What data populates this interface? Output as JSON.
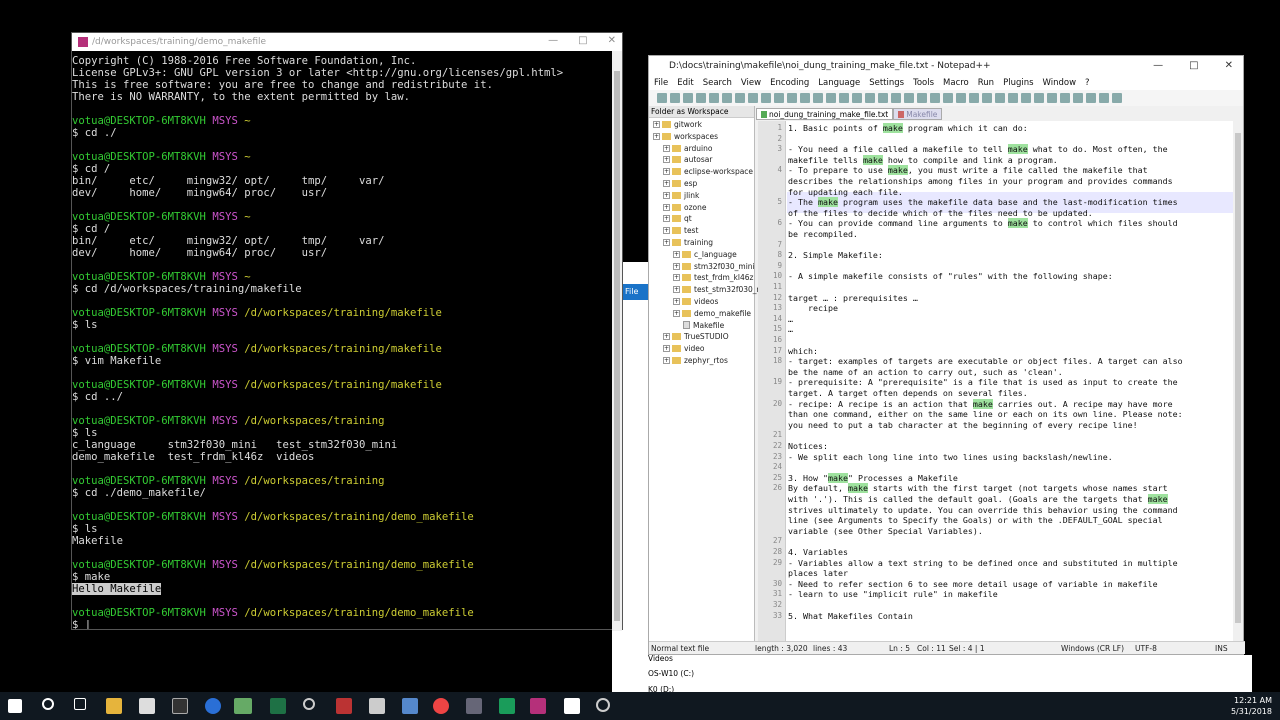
{
  "terminal": {
    "title": "/d/workspaces/training/demo_makefile",
    "lines": [
      [
        [
          "Copyright (C) 1988-2016 Free Software Foundation, Inc.",
          ""
        ]
      ],
      [
        [
          "License GPLv3+: GNU GPL version 3 or later <http://gnu.org/licenses/gpl.html>",
          ""
        ]
      ],
      [
        [
          "This is free software: you are free to change and redistribute it.",
          ""
        ]
      ],
      [
        [
          "There is NO WARRANTY, to the extent permitted by law.",
          ""
        ]
      ],
      [
        [
          "",
          ""
        ]
      ],
      [
        [
          "votua@DESKTOP-6MT8KVH",
          "t-user"
        ],
        [
          " MSYS",
          "t-msys"
        ],
        [
          " ~",
          "t-path"
        ]
      ],
      [
        [
          "$ cd ./",
          ""
        ]
      ],
      [
        [
          "",
          ""
        ]
      ],
      [
        [
          "votua@DESKTOP-6MT8KVH",
          "t-user"
        ],
        [
          " MSYS",
          "t-msys"
        ],
        [
          " ~",
          "t-path"
        ]
      ],
      [
        [
          "$ cd /",
          ""
        ]
      ],
      [
        [
          "bin/     etc/     mingw32/ opt/     tmp/     var/",
          ""
        ]
      ],
      [
        [
          "dev/     home/    mingw64/ proc/    usr/",
          ""
        ]
      ],
      [
        [
          "",
          ""
        ]
      ],
      [
        [
          "votua@DESKTOP-6MT8KVH",
          "t-user"
        ],
        [
          " MSYS",
          "t-msys"
        ],
        [
          " ~",
          "t-path"
        ]
      ],
      [
        [
          "$ cd /",
          ""
        ]
      ],
      [
        [
          "bin/     etc/     mingw32/ opt/     tmp/     var/",
          ""
        ]
      ],
      [
        [
          "dev/     home/    mingw64/ proc/    usr/",
          ""
        ]
      ],
      [
        [
          "",
          ""
        ]
      ],
      [
        [
          "votua@DESKTOP-6MT8KVH",
          "t-user"
        ],
        [
          " MSYS",
          "t-msys"
        ],
        [
          " ~",
          "t-path"
        ]
      ],
      [
        [
          "$ cd /d/workspaces/training/makefile",
          ""
        ]
      ],
      [
        [
          "",
          ""
        ]
      ],
      [
        [
          "votua@DESKTOP-6MT8KVH",
          "t-user"
        ],
        [
          " MSYS",
          "t-msys"
        ],
        [
          " /d/workspaces/training/makefile",
          "t-path"
        ]
      ],
      [
        [
          "$ ls",
          ""
        ]
      ],
      [
        [
          "",
          ""
        ]
      ],
      [
        [
          "votua@DESKTOP-6MT8KVH",
          "t-user"
        ],
        [
          " MSYS",
          "t-msys"
        ],
        [
          " /d/workspaces/training/makefile",
          "t-path"
        ]
      ],
      [
        [
          "$ vim Makefile",
          ""
        ]
      ],
      [
        [
          "",
          ""
        ]
      ],
      [
        [
          "votua@DESKTOP-6MT8KVH",
          "t-user"
        ],
        [
          " MSYS",
          "t-msys"
        ],
        [
          " /d/workspaces/training/makefile",
          "t-path"
        ]
      ],
      [
        [
          "$ cd ../",
          ""
        ]
      ],
      [
        [
          "",
          ""
        ]
      ],
      [
        [
          "votua@DESKTOP-6MT8KVH",
          "t-user"
        ],
        [
          " MSYS",
          "t-msys"
        ],
        [
          " /d/workspaces/training",
          "t-path"
        ]
      ],
      [
        [
          "$ ls",
          ""
        ]
      ],
      [
        [
          "c_language     stm32f030_mini   test_stm32f030_mini",
          ""
        ]
      ],
      [
        [
          "demo_makefile  test_frdm_kl46z  videos",
          ""
        ]
      ],
      [
        [
          "",
          ""
        ]
      ],
      [
        [
          "votua@DESKTOP-6MT8KVH",
          "t-user"
        ],
        [
          " MSYS",
          "t-msys"
        ],
        [
          " /d/workspaces/training",
          "t-path"
        ]
      ],
      [
        [
          "$ cd ./demo_makefile/",
          ""
        ]
      ],
      [
        [
          "",
          ""
        ]
      ],
      [
        [
          "votua@DESKTOP-6MT8KVH",
          "t-user"
        ],
        [
          " MSYS",
          "t-msys"
        ],
        [
          " /d/workspaces/training/demo_makefile",
          "t-path"
        ]
      ],
      [
        [
          "$ ls",
          ""
        ]
      ],
      [
        [
          "Makefile",
          ""
        ]
      ],
      [
        [
          "",
          ""
        ]
      ],
      [
        [
          "votua@DESKTOP-6MT8KVH",
          "t-user"
        ],
        [
          " MSYS",
          "t-msys"
        ],
        [
          " /d/workspaces/training/demo_makefile",
          "t-path"
        ]
      ],
      [
        [
          "$ make",
          ""
        ]
      ],
      [
        [
          "Hello Makefile",
          "t-hl"
        ]
      ],
      [
        [
          "",
          ""
        ]
      ],
      [
        [
          "votua@DESKTOP-6MT8KVH",
          "t-user"
        ],
        [
          " MSYS",
          "t-msys"
        ],
        [
          " /d/workspaces/training/demo_makefile",
          "t-path"
        ]
      ],
      [
        [
          "$ ",
          ""
        ]
      ]
    ]
  },
  "notepad": {
    "title": "D:\\docs\\training\\makefile\\noi_dung_training_make_file.txt - Notepad++",
    "menu": [
      "File",
      "Edit",
      "Search",
      "View",
      "Encoding",
      "Language",
      "Settings",
      "Tools",
      "Macro",
      "Run",
      "Plugins",
      "Window",
      "?"
    ],
    "panel_title": "Folder as Workspace",
    "tree": [
      {
        "label": "gitwork",
        "indent": 0,
        "type": "folder"
      },
      {
        "label": "workspaces",
        "indent": 0,
        "type": "folder"
      },
      {
        "label": "arduino",
        "indent": 1,
        "type": "folder"
      },
      {
        "label": "autosar",
        "indent": 1,
        "type": "folder"
      },
      {
        "label": "eclipse-workspace",
        "indent": 1,
        "type": "folder"
      },
      {
        "label": "esp",
        "indent": 1,
        "type": "folder"
      },
      {
        "label": "jlink",
        "indent": 1,
        "type": "folder"
      },
      {
        "label": "ozone",
        "indent": 1,
        "type": "folder"
      },
      {
        "label": "qt",
        "indent": 1,
        "type": "folder"
      },
      {
        "label": "test",
        "indent": 1,
        "type": "folder"
      },
      {
        "label": "training",
        "indent": 1,
        "type": "folder"
      },
      {
        "label": "c_language",
        "indent": 2,
        "type": "folder"
      },
      {
        "label": "stm32f030_mini",
        "indent": 2,
        "type": "folder"
      },
      {
        "label": "test_frdm_kl46z",
        "indent": 2,
        "type": "folder"
      },
      {
        "label": "test_stm32f030_mini",
        "indent": 2,
        "type": "folder"
      },
      {
        "label": "videos",
        "indent": 2,
        "type": "folder"
      },
      {
        "label": "demo_makefile",
        "indent": 2,
        "type": "folder"
      },
      {
        "label": "Makefile",
        "indent": 3,
        "type": "file"
      },
      {
        "label": "TrueSTUDIO",
        "indent": 1,
        "type": "folder"
      },
      {
        "label": "video",
        "indent": 1,
        "type": "folder"
      },
      {
        "label": "zephyr_rtos",
        "indent": 1,
        "type": "folder"
      }
    ],
    "tabs": [
      {
        "label": "noi_dung_training_make_file.txt",
        "active": true
      },
      {
        "label": "Makefile",
        "active": false
      }
    ],
    "editor_rows": [
      {
        "n": "1",
        "t": "1. Basic points of |make| program which it can do:"
      },
      {
        "n": "2",
        "t": ""
      },
      {
        "n": "3",
        "t": "- You need a file called a makefile to tell |make| what to do. Most often, the"
      },
      {
        "n": "",
        "t": "makefile tells |make| how to compile and link a program."
      },
      {
        "n": "4",
        "t": "- To prepare to use |make|, you must write a file called the makefile that"
      },
      {
        "n": "",
        "t": "describes the relationships among files in your program and provides commands"
      },
      {
        "n": "",
        "t": "for updating each file."
      },
      {
        "n": "5",
        "t": "- The |make| program uses the makefile data base and the last-modification times"
      },
      {
        "n": "",
        "t": "of the files to decide which of the files need to be updated."
      },
      {
        "n": "6",
        "t": "- You can provide command line arguments to |make| to control which files should"
      },
      {
        "n": "",
        "t": "be recompiled."
      },
      {
        "n": "7",
        "t": ""
      },
      {
        "n": "8",
        "t": "2. Simple Makefile:"
      },
      {
        "n": "9",
        "t": ""
      },
      {
        "n": "10",
        "t": "- A simple makefile consists of \"rules\" with the following shape:"
      },
      {
        "n": "11",
        "t": ""
      },
      {
        "n": "12",
        "t": "target … : prerequisites …"
      },
      {
        "n": "13",
        "t": "    recipe"
      },
      {
        "n": "14",
        "t": "…"
      },
      {
        "n": "15",
        "t": "…"
      },
      {
        "n": "16",
        "t": ""
      },
      {
        "n": "17",
        "t": "which:"
      },
      {
        "n": "18",
        "t": "- target: examples of targets are executable or object files. A target can also"
      },
      {
        "n": "",
        "t": "be the name of an action to carry out, such as 'clean'."
      },
      {
        "n": "19",
        "t": "- prerequisite: A \"prerequisite\" is a file that is used as input to create the"
      },
      {
        "n": "",
        "t": "target. A target often depends on several files."
      },
      {
        "n": "20",
        "t": "- recipe: A recipe is an action that |make| carries out. A recipe may have more"
      },
      {
        "n": "",
        "t": "than one command, either on the same line or each on its own line. Please note:"
      },
      {
        "n": "",
        "t": "you need to put a tab character at the beginning of every recipe line!"
      },
      {
        "n": "21",
        "t": ""
      },
      {
        "n": "22",
        "t": "Notices:"
      },
      {
        "n": "23",
        "t": "- We split each long line into two lines using backslash/newline."
      },
      {
        "n": "24",
        "t": ""
      },
      {
        "n": "25",
        "t": "3. How \"|make|\" Processes a Makefile"
      },
      {
        "n": "26",
        "t": "By default, |make| starts with the first target (not targets whose names start"
      },
      {
        "n": "",
        "t": "with '.'). This is called the default goal. (Goals are the targets that |make|"
      },
      {
        "n": "",
        "t": "strives ultimately to update. You can override this behavior using the command"
      },
      {
        "n": "",
        "t": "line (see Arguments to Specify the Goals) or with the .DEFAULT_GOAL special"
      },
      {
        "n": "",
        "t": "variable (see Other Special Variables)."
      },
      {
        "n": "27",
        "t": ""
      },
      {
        "n": "28",
        "t": "4. Variables"
      },
      {
        "n": "29",
        "t": "- Variables allow a text string to be defined once and substituted in multiple"
      },
      {
        "n": "",
        "t": "places later"
      },
      {
        "n": "30",
        "t": "- Need to refer section 6 to see more detail usage of variable in makefile"
      },
      {
        "n": "31",
        "t": "- learn to use \"implicit rule\" in makefile"
      },
      {
        "n": "32",
        "t": ""
      },
      {
        "n": "33",
        "t": "5. What Makefiles Contain"
      }
    ],
    "status": {
      "type": "Normal text file",
      "length": "length : 3,020",
      "lines": "lines : 43",
      "pos": "Ln : 5",
      "col": "Col : 11",
      "sel": "Sel : 4 | 1",
      "eol": "Windows (CR LF)",
      "enc": "UTF-8",
      "mode": "INS"
    }
  },
  "explorer_peek": {
    "file_tab": "File",
    "items": [
      "Videos",
      "OS-W10 (C:)",
      "K0 (D:)"
    ]
  },
  "taskbar": {
    "time": "12:21 AM",
    "date": "5/31/2018"
  },
  "colors": {
    "prompt_user": "#33cc33",
    "prompt_msys": "#cc55cc",
    "prompt_path": "#cccc33",
    "highlight_make": "#9ee29e"
  }
}
